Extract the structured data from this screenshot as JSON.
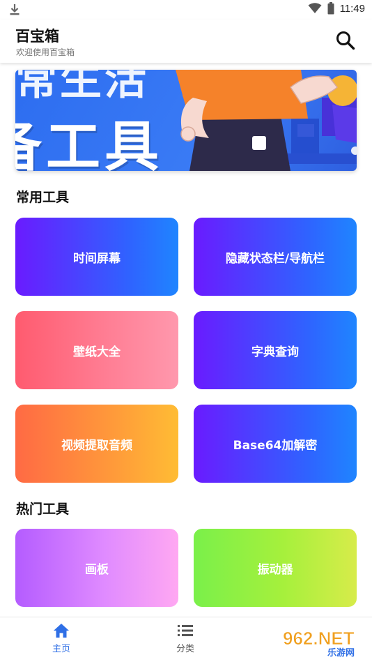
{
  "status_bar": {
    "time": "11:49",
    "icons": [
      "download-icon",
      "wifi-icon",
      "battery-icon"
    ]
  },
  "header": {
    "title": "百宝箱",
    "subtitle": "欢迎使用百宝箱",
    "search_icon": "search-icon"
  },
  "banner": {
    "text_top": "常生活",
    "text_main": "备工具"
  },
  "sections": {
    "common": {
      "title": "常用工具",
      "items": [
        {
          "label": "时间屏幕"
        },
        {
          "label": "隐藏状态栏/导航栏"
        },
        {
          "label": "壁纸大全"
        },
        {
          "label": "字典查询"
        },
        {
          "label": "视频提取音频"
        },
        {
          "label": "Base64加解密"
        }
      ]
    },
    "hot": {
      "title": "热门工具",
      "items": [
        {
          "label": "画板"
        },
        {
          "label": "振动器"
        }
      ]
    }
  },
  "bottom_nav": {
    "items": [
      {
        "label": "主页",
        "icon": "home-icon",
        "active": true
      },
      {
        "label": "分类",
        "icon": "list-icon",
        "active": false
      }
    ]
  },
  "watermark": {
    "brand": "962.NET",
    "sub": "乐游网"
  },
  "colors": {
    "accent": "#2f6fe6",
    "banner_bg": "#3a7bf5"
  }
}
